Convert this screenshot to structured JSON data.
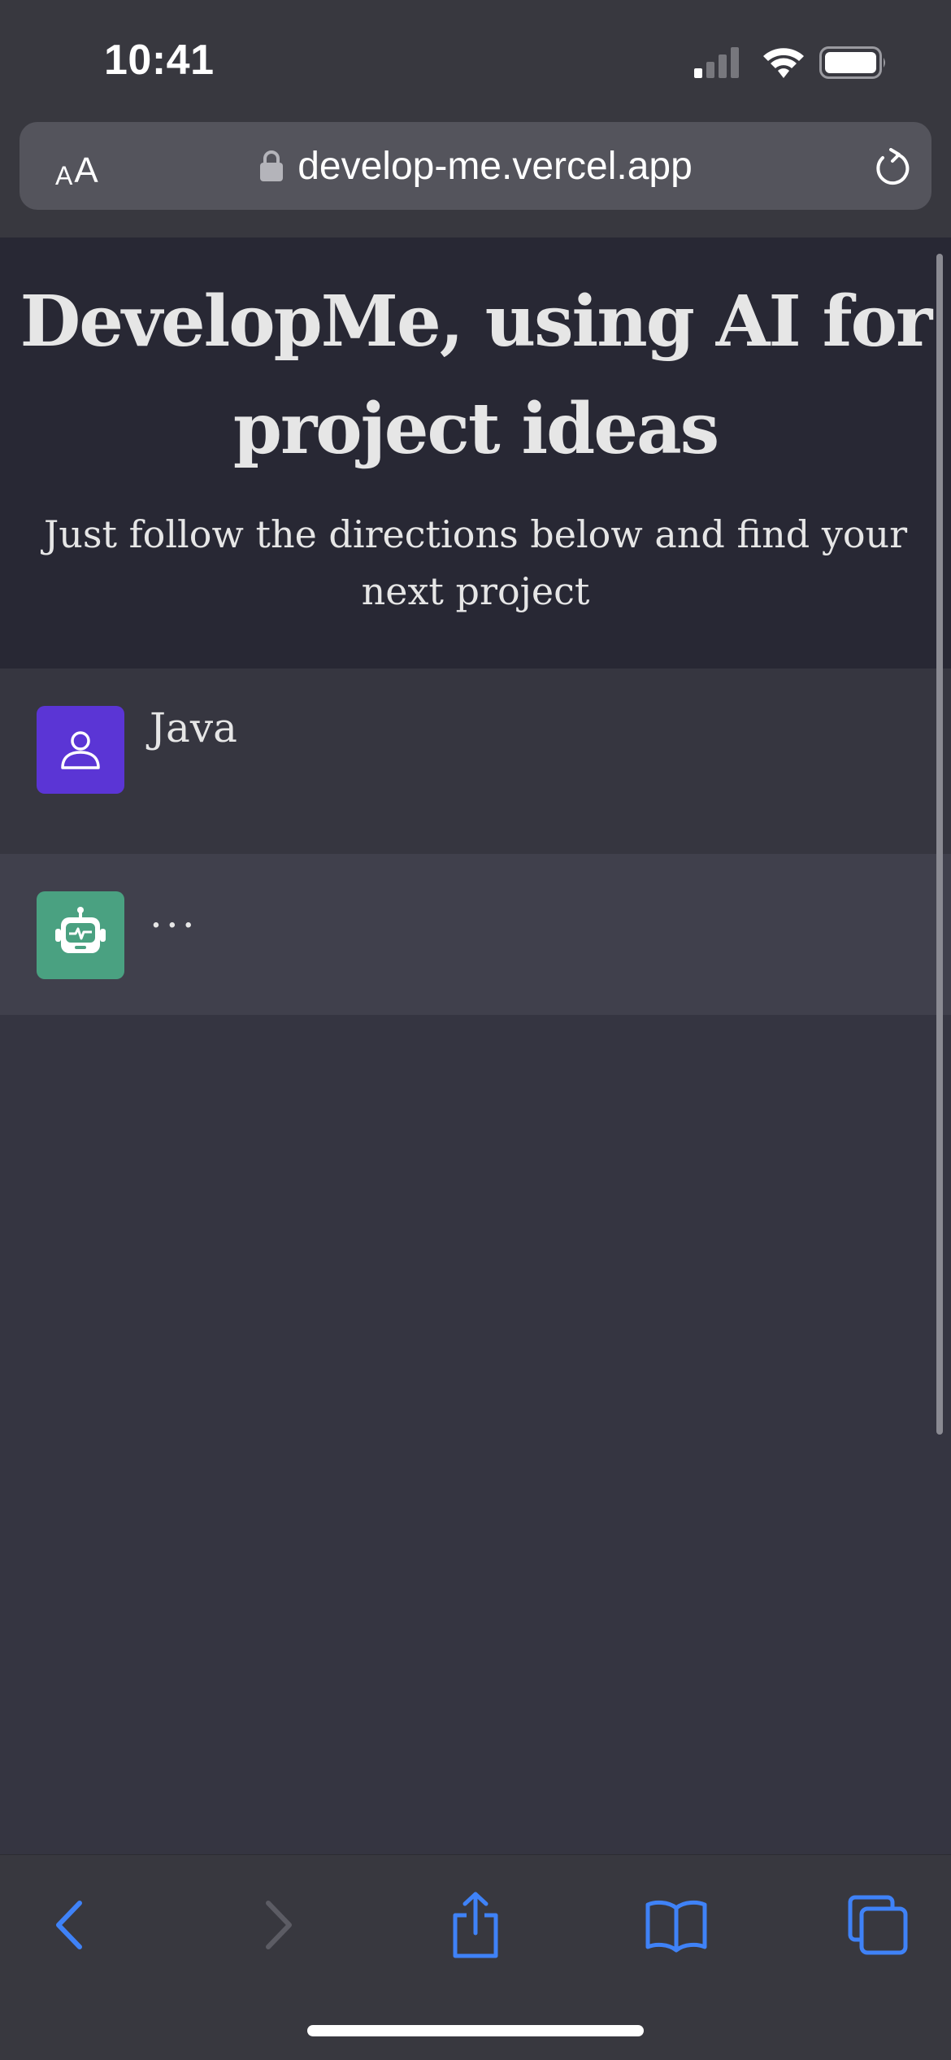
{
  "status_bar": {
    "time": "10:41",
    "icons": [
      "cellular-signal-icon",
      "wifi-icon",
      "battery-icon"
    ]
  },
  "browser": {
    "text_size_small": "A",
    "text_size_large": "A",
    "url": "develop-me.vercel.app",
    "icons": [
      "lock-icon",
      "reload-icon"
    ]
  },
  "page": {
    "title": "DevelopMe, using AI for project ideas",
    "subtitle": "Just follow the directions below and find your next project"
  },
  "conversation": {
    "messages": [
      {
        "role": "user",
        "avatar_icon": "user-icon",
        "text": "Java"
      },
      {
        "role": "assistant",
        "avatar_icon": "robot-icon",
        "text": "..."
      }
    ]
  },
  "toolbar": {
    "buttons": [
      "back-icon",
      "forward-icon",
      "share-icon",
      "bookmarks-icon",
      "tabs-icon"
    ]
  },
  "colors": {
    "user_avatar": "#5b35d5",
    "bot_avatar": "#4aa181",
    "toolbar_accent": "#3f82f7",
    "header_bg": "#282834",
    "page_bg": "#353541"
  }
}
